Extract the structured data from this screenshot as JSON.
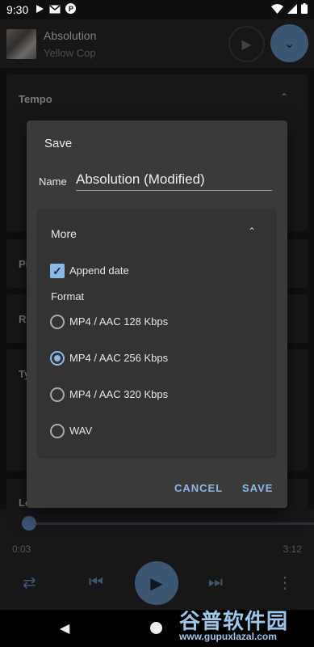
{
  "status_bar": {
    "time": "9:30",
    "icons": [
      "play-store-icon",
      "gmail-icon",
      "p-icon",
      "wifi-icon",
      "signal-icon",
      "battery-icon"
    ]
  },
  "now_playing": {
    "title": "Absolution",
    "artist": "Yellow Cop"
  },
  "background_sections": {
    "tempo": "Tempo",
    "pitch_partial": "Pi",
    "rate_partial": "Ra",
    "type_partial": "Ty",
    "loop_partial": "Lo"
  },
  "dialog": {
    "title": "Save",
    "name_label": "Name",
    "name_value": "Absolution (Modified)",
    "more": {
      "label": "More",
      "append_date_label": "Append date",
      "append_date_checked": true,
      "format_label": "Format",
      "formats": [
        {
          "label": "MP4 / AAC 128 Kbps",
          "selected": false
        },
        {
          "label": "MP4 / AAC 256 Kbps",
          "selected": true
        },
        {
          "label": "MP4 / AAC 320 Kbps",
          "selected": false
        },
        {
          "label": "WAV",
          "selected": false
        }
      ]
    },
    "cancel_label": "CANCEL",
    "save_label": "SAVE"
  },
  "player": {
    "elapsed": "0:03",
    "duration": "3:12",
    "progress_fraction": 0.016
  },
  "watermark": {
    "main": "谷普软件园",
    "sub": "www.gupuxlazal.com"
  },
  "colors": {
    "accent": "#6f9dd4",
    "dialog_bg": "#3a3a3a",
    "surface": "#2b2b2b"
  }
}
